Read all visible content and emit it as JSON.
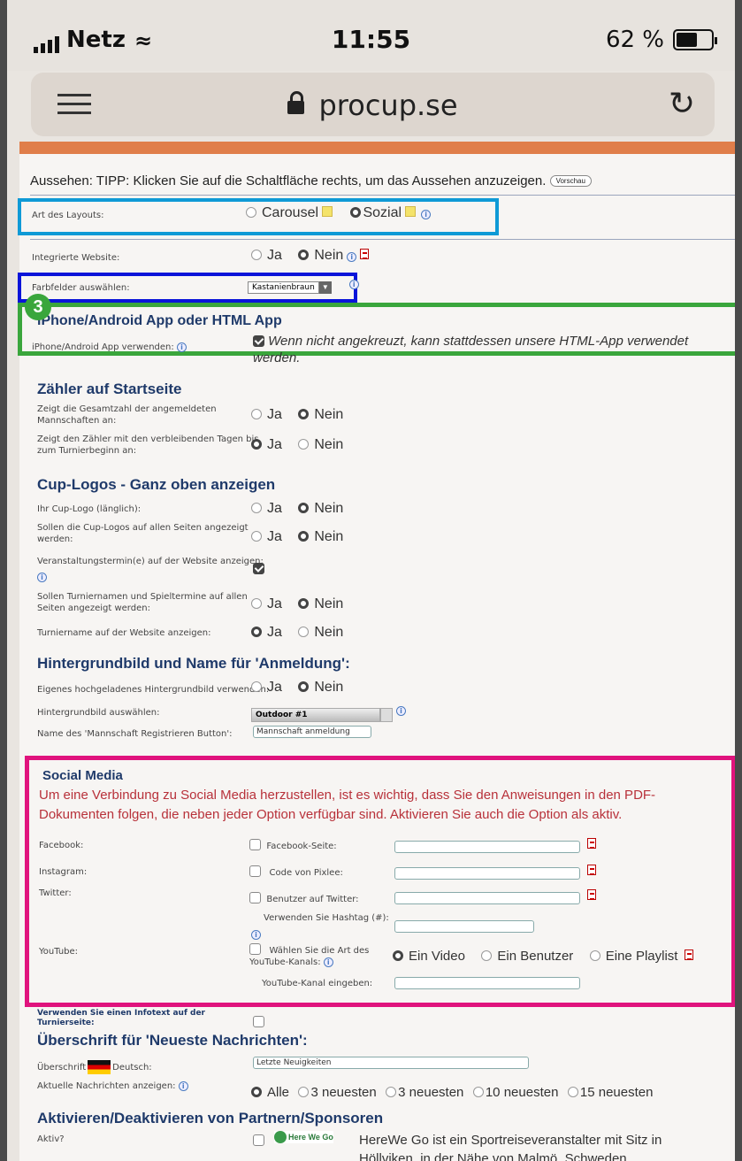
{
  "status": {
    "carrier": "Netz",
    "time": "11:55",
    "battery": "62 %"
  },
  "browser": {
    "url": "procup.se"
  },
  "appearance": {
    "tip": "Aussehen: TIPP: Klicken Sie auf die Schaltfläche rechts, um das Aussehen anzuzeigen.",
    "preview": "Vorschau"
  },
  "layout": {
    "label": "Art des Layouts:",
    "opt1": "Carousel",
    "opt2": "Sozial"
  },
  "website": {
    "label": "Integrierte Website:",
    "yes": "Ja",
    "no": "Nein"
  },
  "color": {
    "label": "Farbfelder auswählen:",
    "value": "Kastanienbraun"
  },
  "badge": "3",
  "app": {
    "heading": "iPhone/Android App oder HTML App",
    "label": "iPhone/Android App verwenden:",
    "text1": "Wenn nicht angekreuzt, kann stattdessen unsere HTML-App verwendet",
    "text2": "werden."
  },
  "counter": {
    "heading": "Zähler auf Startseite",
    "l1a": "Zeigt die Gesamtzahl der angemeldeten",
    "l1b": "Mannschaften an:",
    "l2a": "Zeigt den Zähler mit den verbleibenden Tagen bis",
    "l2b": "zum Turnierbeginn an:"
  },
  "logos": {
    "heading": "Cup-Logos - Ganz oben anzeigen",
    "l1": "Ihr Cup-Logo (länglich):",
    "l2a": "Sollen die Cup-Logos auf allen Seiten angezeigt",
    "l2b": "werden:",
    "l3": "Veranstaltungstermin(e) auf der Website anzeigen:",
    "l4a": "Sollen Turniernamen und Spieltermine auf allen",
    "l4b": "Seiten angezeigt werden:",
    "l5": "Turniername auf der Website anzeigen:"
  },
  "bg": {
    "heading": "Hintergrundbild und Name für 'Anmeldung':",
    "l1": "Eigenes hochgeladenes Hintergrundbild verwenden:",
    "l2": "Hintergrundbild auswählen:",
    "select": "Outdoor #1",
    "l3": "Name des 'Mannschaft Registrieren Button':",
    "btn": "Mannschaft anmeldung"
  },
  "social": {
    "heading": "Social Media",
    "desc1": "Um eine Verbindung zu Social Media herzustellen, ist es wichtig, dass Sie den Anweisungen in den PDF-",
    "desc2": "Dokumenten folgen, die neben jeder Option verfügbar sind. Aktivieren Sie auch die Option als aktiv.",
    "fb": "Facebook:",
    "fbopt": "Facebook-Seite:",
    "ig": "Instagram:",
    "igopt": "Code von Pixlee:",
    "tw": "Twitter:",
    "twopt": "Benutzer auf Twitter:",
    "hash": "Verwenden Sie Hashtag (#):",
    "yt": "YouTube:",
    "ytopt1": "Wählen Sie die Art des",
    "ytopt2": "YouTube-Kanals:",
    "v1": "Ein Video",
    "v2": "Ein Benutzer",
    "v3": "Eine Playlist",
    "ytchan": "YouTube-Kanal eingeben:"
  },
  "infotext": {
    "l1": "Verwenden Sie einen Infotext auf der",
    "l2": "Turnierseite:"
  },
  "news": {
    "heading": "Überschrift für 'Neueste Nachrichten':",
    "l1": "Überschrift",
    "lang": "Deutsch:",
    "value": "Letzte Neuigkeiten",
    "l2": "Aktuelle Nachrichten anzeigen:",
    "o1": "Alle",
    "o2": "3 neuesten",
    "o3": "3 neuesten",
    "o4": "10 neuesten",
    "o5": "15 neuesten"
  },
  "partners": {
    "heading": "Aktivieren/Deaktivieren von Partnern/Sponsoren",
    "label": "Aktiv?",
    "logo": "Here We Go",
    "text1": "HereWe Go ist ein Sportreiseveranstalter mit Sitz in",
    "text2": "Höllviken, in der Nähe von Malmö, Schweden."
  },
  "colors": {
    "cyan": "#0f9ad6",
    "blue": "#0a14d9",
    "green": "#3aa63c",
    "pink": "#e0137d",
    "heading": "#1f3a6a",
    "social_text": "#b8313a"
  }
}
